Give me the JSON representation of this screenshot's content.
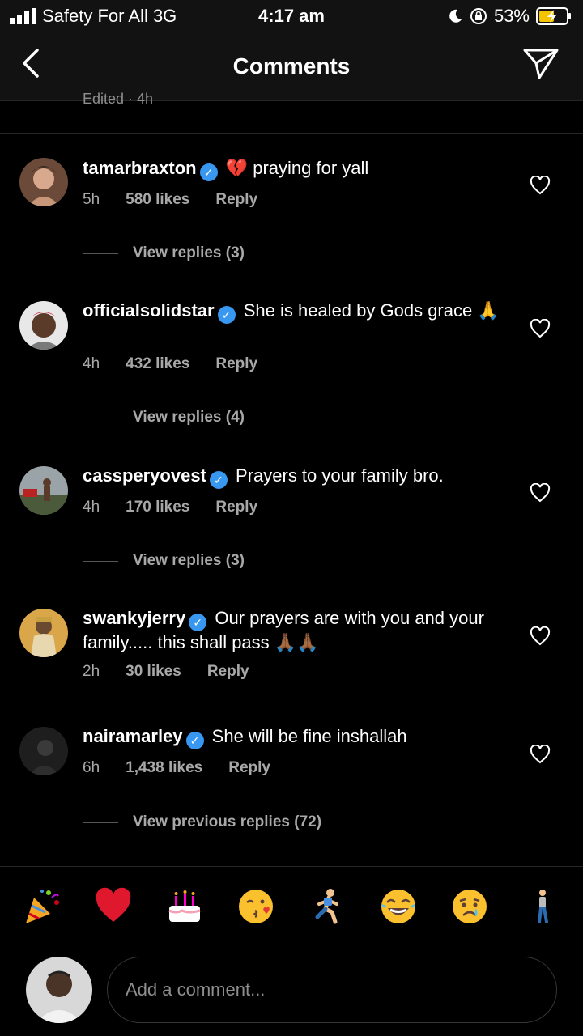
{
  "status": {
    "carrier": "Safety For All  3G",
    "time": "4:17 am",
    "battery": "53%"
  },
  "header": {
    "title": "Comments"
  },
  "edited_text": "Edited · 4h",
  "comments": [
    {
      "username": "tamarbraxton",
      "text": "💔  praying for yall",
      "time": "5h",
      "likes": "580 likes",
      "reply": "Reply",
      "view_replies": "View replies (3)"
    },
    {
      "username": "officialsolidstar",
      "text": "She is healed by Gods grace 🙏",
      "time": "4h",
      "likes": "432 likes",
      "reply": "Reply",
      "view_replies": "View replies (4)"
    },
    {
      "username": "cassperyovest",
      "text": "Prayers to your family bro.",
      "time": "4h",
      "likes": "170 likes",
      "reply": "Reply",
      "view_replies": "View replies (3)"
    },
    {
      "username": "swankyjerry",
      "text": "Our prayers are with you and your family..... this shall pass 🙏🏾🙏🏾",
      "time": "2h",
      "likes": "30 likes",
      "reply": "Reply"
    },
    {
      "username": "nairamarley",
      "text": "She will be fine inshallah",
      "time": "6h",
      "likes": "1,438 likes",
      "reply": "Reply",
      "view_replies": "View previous replies (72)"
    }
  ],
  "emoji_bar": [
    "🎉",
    "❤️",
    "🎂",
    "😘",
    "🏃",
    "😂",
    "😢",
    "🚶"
  ],
  "input": {
    "placeholder": "Add a comment..."
  },
  "colors": {
    "background": "#000000",
    "verified": "#3897f0",
    "muted": "#a8a8a8"
  }
}
